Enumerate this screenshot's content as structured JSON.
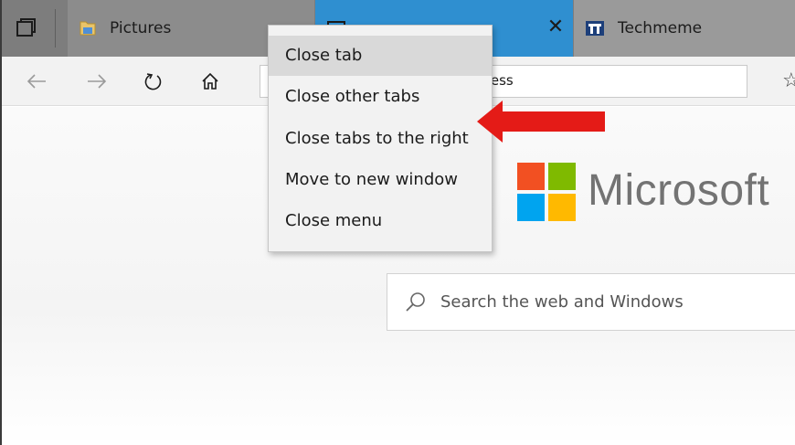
{
  "tabs": [
    {
      "label": "Pictures",
      "icon": "folder-icon"
    },
    {
      "label": "",
      "icon": "page-icon",
      "active": true,
      "close": "✕"
    },
    {
      "label": "Techmeme",
      "icon": "techmeme-icon"
    }
  ],
  "navbar": {
    "back": "←",
    "forward": "→",
    "refresh": "↻",
    "home": "⌂",
    "address_visible_text": "ress",
    "favorite": "☆"
  },
  "context_menu": {
    "items": [
      "Close tab",
      "Close other tabs",
      "Close tabs to the right",
      "Move to new window",
      "Close menu"
    ],
    "highlighted_index": 0
  },
  "page": {
    "logo_text": "Microsoft",
    "logo_colors": [
      "#f25022",
      "#7fba00",
      "#00a4ef",
      "#ffb900"
    ],
    "search_placeholder": "Search the web and Windows"
  },
  "annotation": {
    "arrow_color": "#e41b17",
    "points_to_item_index": 1
  }
}
